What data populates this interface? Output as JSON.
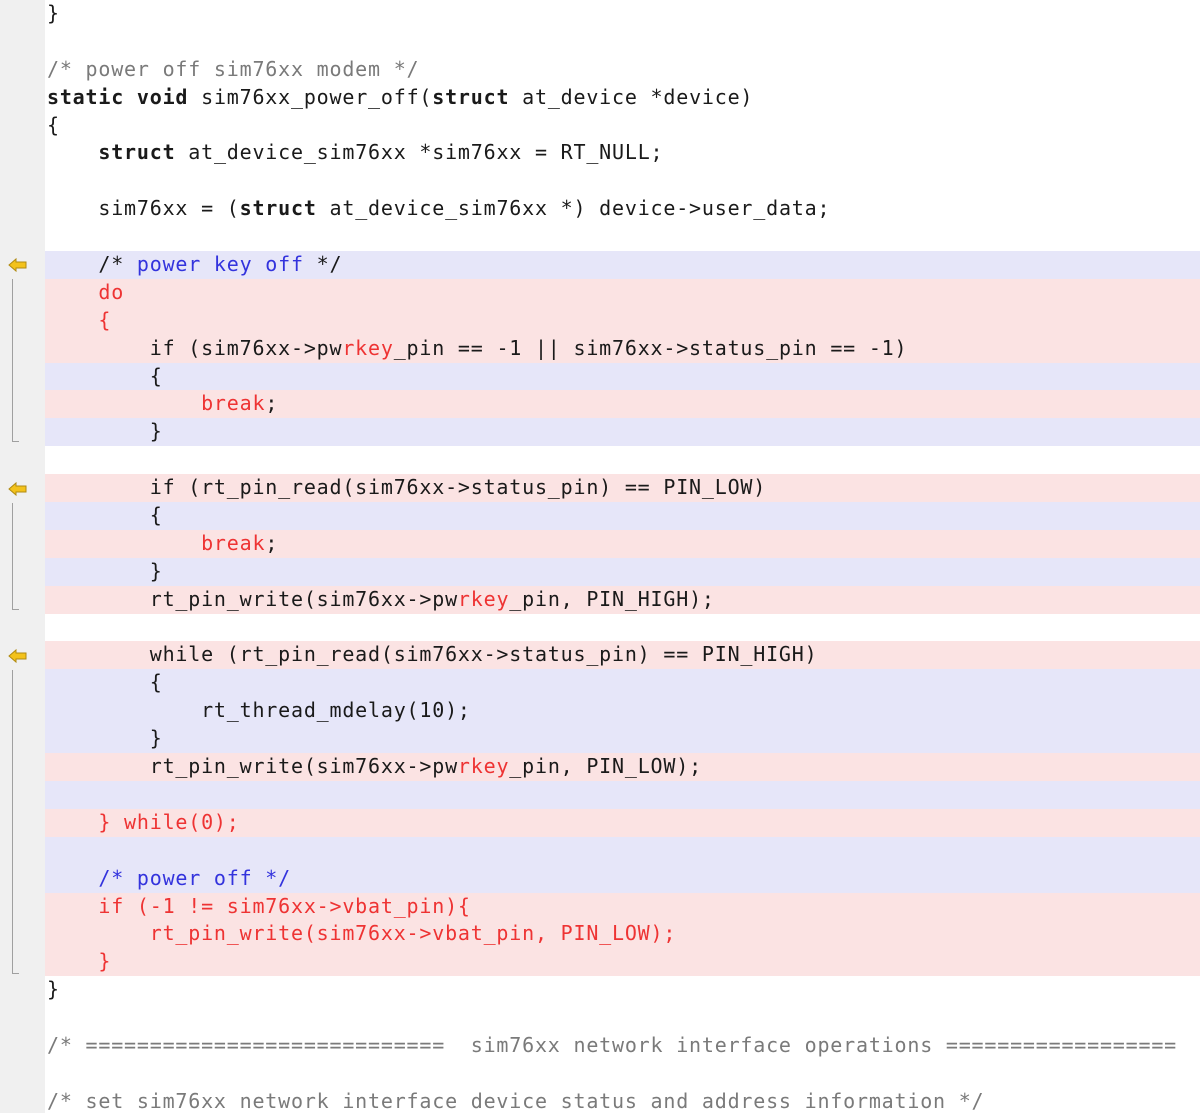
{
  "code_lines": [
    {
      "bg": "",
      "parts": [
        {
          "t": "}",
          "c": ""
        }
      ]
    },
    {
      "bg": "",
      "parts": []
    },
    {
      "bg": "",
      "parts": [
        {
          "t": "/* power off sim76xx modem */",
          "c": "cm"
        }
      ]
    },
    {
      "bg": "",
      "parts": [
        {
          "t": "static",
          "c": "kw"
        },
        {
          "t": " ",
          "c": ""
        },
        {
          "t": "void",
          "c": "kw"
        },
        {
          "t": " sim76xx_power_off(",
          "c": ""
        },
        {
          "t": "struct",
          "c": "kw"
        },
        {
          "t": " at_device *device)",
          "c": ""
        }
      ]
    },
    {
      "bg": "",
      "parts": [
        {
          "t": "{",
          "c": ""
        }
      ]
    },
    {
      "bg": "",
      "parts": [
        {
          "t": "    ",
          "c": ""
        },
        {
          "t": "struct",
          "c": "kw"
        },
        {
          "t": " at_device_sim76xx *sim76xx = RT_NULL;",
          "c": ""
        }
      ]
    },
    {
      "bg": "",
      "parts": []
    },
    {
      "bg": "",
      "parts": [
        {
          "t": "    sim76xx = (",
          "c": ""
        },
        {
          "t": "struct",
          "c": "kw"
        },
        {
          "t": " at_device_sim76xx *) device->user_data;",
          "c": ""
        }
      ]
    },
    {
      "bg": "",
      "parts": []
    },
    {
      "bg": "b",
      "parts": [
        {
          "t": "    /* ",
          "c": ""
        },
        {
          "t": "power key off",
          "c": "cmb"
        },
        {
          "t": " */",
          "c": ""
        }
      ]
    },
    {
      "bg": "r",
      "parts": [
        {
          "t": "    do",
          "c": "red"
        }
      ]
    },
    {
      "bg": "r",
      "parts": [
        {
          "t": "    {",
          "c": "red"
        }
      ]
    },
    {
      "bg": "r",
      "parts": [
        {
          "t": "        if (sim76xx->pw",
          "c": ""
        },
        {
          "t": "rkey",
          "c": "hl"
        },
        {
          "t": "_pin == -1 || sim76xx->status_pin == -1)",
          "c": ""
        }
      ]
    },
    {
      "bg": "b",
      "parts": [
        {
          "t": "        {",
          "c": ""
        }
      ]
    },
    {
      "bg": "r",
      "parts": [
        {
          "t": "            bre",
          "c": "red"
        },
        {
          "t": "ak",
          "c": "hl"
        },
        {
          "t": ";",
          "c": ""
        }
      ]
    },
    {
      "bg": "b",
      "parts": [
        {
          "t": "        }",
          "c": ""
        }
      ]
    },
    {
      "bg": "",
      "parts": []
    },
    {
      "bg": "r",
      "parts": [
        {
          "t": "        if (rt_pin_read(sim76xx->status_pin) == PIN_LOW)",
          "c": ""
        }
      ]
    },
    {
      "bg": "b",
      "parts": [
        {
          "t": "        {",
          "c": ""
        }
      ]
    },
    {
      "bg": "r",
      "parts": [
        {
          "t": "            bre",
          "c": "red"
        },
        {
          "t": "ak",
          "c": "hl"
        },
        {
          "t": ";",
          "c": ""
        }
      ]
    },
    {
      "bg": "b",
      "parts": [
        {
          "t": "        }",
          "c": ""
        }
      ]
    },
    {
      "bg": "r",
      "parts": [
        {
          "t": "        rt_pin_write(sim76xx->pw",
          "c": ""
        },
        {
          "t": "rkey",
          "c": "hl"
        },
        {
          "t": "_pin, PIN_HIGH);",
          "c": ""
        }
      ]
    },
    {
      "bg": "",
      "parts": []
    },
    {
      "bg": "r",
      "parts": [
        {
          "t": "        while (rt_pin_read(sim76xx->status_pin) == PIN_HIGH)",
          "c": ""
        }
      ]
    },
    {
      "bg": "b",
      "parts": [
        {
          "t": "        {",
          "c": ""
        }
      ]
    },
    {
      "bg": "b",
      "parts": [
        {
          "t": "            rt_thread_mdelay(10);",
          "c": ""
        }
      ]
    },
    {
      "bg": "b",
      "parts": [
        {
          "t": "        }",
          "c": ""
        }
      ]
    },
    {
      "bg": "r",
      "parts": [
        {
          "t": "        rt_pin_write(sim76xx->pw",
          "c": ""
        },
        {
          "t": "rkey",
          "c": "hl"
        },
        {
          "t": "_pin, PIN_LOW);",
          "c": ""
        }
      ]
    },
    {
      "bg": "b",
      "parts": []
    },
    {
      "bg": "r",
      "parts": [
        {
          "t": "    } while(0);",
          "c": "red"
        }
      ]
    },
    {
      "bg": "b",
      "parts": []
    },
    {
      "bg": "b",
      "parts": [
        {
          "t": "    /* power off */",
          "c": "cmb"
        }
      ]
    },
    {
      "bg": "r",
      "parts": [
        {
          "t": "    if (-1 != sim76xx->vbat_pin){",
          "c": "red"
        }
      ]
    },
    {
      "bg": "r",
      "parts": [
        {
          "t": "        rt_pin_write(sim76xx->vbat_pin, PIN_LOW);",
          "c": "red"
        }
      ]
    },
    {
      "bg": "r",
      "parts": [
        {
          "t": "    }",
          "c": "red"
        }
      ]
    },
    {
      "bg": "",
      "parts": [
        {
          "t": "}",
          "c": ""
        }
      ]
    },
    {
      "bg": "",
      "parts": []
    },
    {
      "bg": "",
      "parts": [
        {
          "t": "/* ============================  sim76xx network interface operations ==================",
          "c": "cm"
        }
      ]
    },
    {
      "bg": "",
      "parts": []
    },
    {
      "bg": "",
      "parts": [
        {
          "t": "/* set sim76xx network interface device status and address information */",
          "c": "cm"
        }
      ]
    }
  ],
  "diff_markers": [
    {
      "icon": "arrow-left-icon",
      "color": "#f3c21b"
    },
    {
      "icon": "arrow-left-icon",
      "color": "#f3c21b"
    },
    {
      "icon": "arrow-left-icon",
      "color": "#f3c21b"
    }
  ],
  "colors": {
    "added_bg": "#fbe3e3",
    "changed_bg": "#e6e6f9",
    "highlight": "#ee3333",
    "comment": "#7a7a7a",
    "comment_blue": "#3333dd",
    "gutter": "#f0f0f0"
  }
}
